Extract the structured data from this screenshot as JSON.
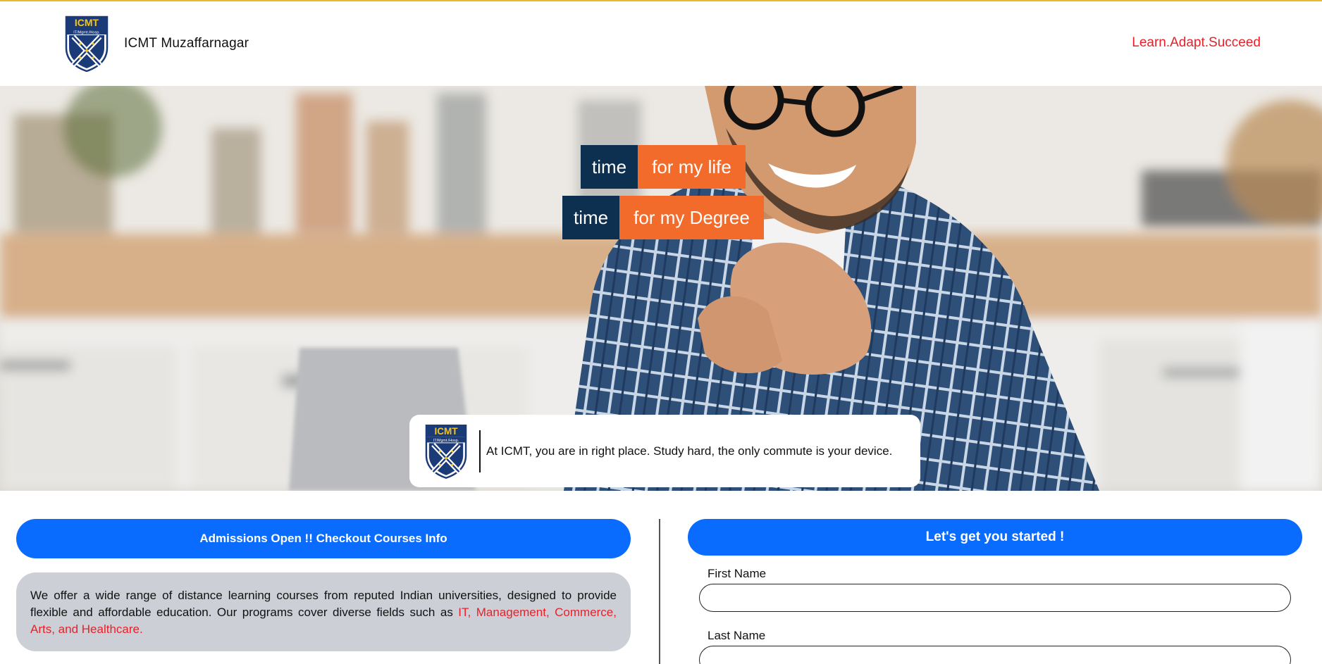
{
  "header": {
    "brand_name": "ICMT Muzaffarnagar",
    "logo_text": "ICMT",
    "logo_subtext": "IT/Mgmt./Hosp.",
    "tagline": "Learn.Adapt.Succeed"
  },
  "hero": {
    "row1": {
      "dark": "time",
      "orange": "for my life"
    },
    "row2": {
      "dark": "time",
      "orange": "for my Degree"
    },
    "card_text": "At ICMT, you are in right place. Study hard, the only commute is your device."
  },
  "courses": {
    "button_label": "Admissions Open !! Checkout Courses Info",
    "description": "We offer a wide range of distance learning courses from reputed Indian universities, designed to provide flexible and affordable education. Our programs cover diverse fields such as ",
    "description_highlight": "IT, Management, Commerce, Arts, and Healthcare."
  },
  "form": {
    "button_label": "Let's get you started !",
    "first_name_label": "First Name",
    "first_name_value": "",
    "last_name_label": "Last Name",
    "last_name_value": ""
  },
  "colors": {
    "accent_blue": "#0a6cff",
    "navy": "#0d2f50",
    "orange": "#f26b2a",
    "red": "#e8202a",
    "top_line": "#e8b92c"
  },
  "icons": [
    "icmt-shield-logo-icon"
  ]
}
